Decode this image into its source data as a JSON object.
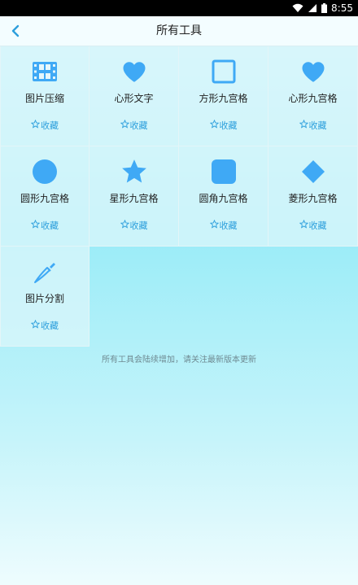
{
  "status_bar": {
    "time": "8:55"
  },
  "header": {
    "title": "所有工具"
  },
  "tools": [
    {
      "name": "图片压缩",
      "icon": "film-compress-icon",
      "fav_label": "收藏"
    },
    {
      "name": "心形文字",
      "icon": "heart-icon",
      "fav_label": "收藏"
    },
    {
      "name": "方形九宫格",
      "icon": "square-outline-icon",
      "fav_label": "收藏"
    },
    {
      "name": "心形九宫格",
      "icon": "heart-icon",
      "fav_label": "收藏"
    },
    {
      "name": "圆形九宫格",
      "icon": "circle-icon",
      "fav_label": "收藏"
    },
    {
      "name": "星形九宫格",
      "icon": "star-icon",
      "fav_label": "收藏"
    },
    {
      "name": "圆角九宫格",
      "icon": "rounded-square-icon",
      "fav_label": "收藏"
    },
    {
      "name": "菱形九宫格",
      "icon": "diamond-icon",
      "fav_label": "收藏"
    },
    {
      "name": "图片分割",
      "icon": "knife-icon",
      "fav_label": "收藏"
    }
  ],
  "footer": {
    "note": "所有工具会陆续增加，请关注最新版本更新"
  },
  "colors": {
    "accent": "#3fa9f5",
    "link": "#2d9fdc"
  }
}
